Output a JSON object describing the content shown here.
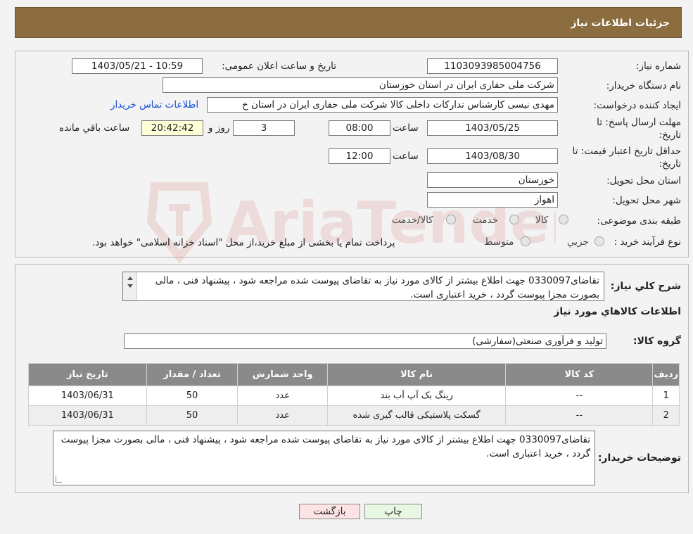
{
  "header": {
    "title": "جزئیات اطلاعات نیاز"
  },
  "form": {
    "need_number_label": "شماره نیاز:",
    "need_number": "1103093985004756",
    "announce_label": "تاریخ و ساعت اعلان عمومی:",
    "announce_value": "1403/05/21 - 10:59",
    "buyer_label": "نام دستگاه خریدار:",
    "buyer_value": "شرکت ملی حفاری ایران در استان خوزستان",
    "creator_label": "ایجاد کننده درخواست:",
    "creator_value": "مهدی نیسی کارشناس تدارکات داخلی کالا شرکت ملی حفاری ایران در استان خ",
    "contact_link": "اطلاعات تماس خریدار",
    "deadline_label_1": "مهلت ارسال پاسخ: تا",
    "deadline_label_2": "تاریخ:",
    "deadline_date": "1403/05/25",
    "time_label": "ساعت",
    "deadline_time": "08:00",
    "days_value": "3",
    "days_label": "روز و",
    "remaining_time": "20:42:42",
    "remaining_label": "ساعت باقي مانده",
    "validity_label_1": "حداقل تاریخ اعتبار قیمت: تا",
    "validity_label_2": "تاریخ:",
    "validity_date": "1403/08/30",
    "validity_time": "12:00",
    "province_label": "استان محل تحویل:",
    "province_value": "خوزستان",
    "city_label": "شهر محل تحویل:",
    "city_value": "اهواز",
    "category_label": "طبقه بندی موضوعی:",
    "category_options": [
      "کالا",
      "خدمت",
      "کالا/خدمت"
    ],
    "process_label": "نوع فرآیند خرید :",
    "process_options": [
      "جزيي",
      "متوسط"
    ],
    "process_note": "پرداخت تمام یا بخشی از مبلغ خرید،از محل \"اسناد خزانه اسلامی\" خواهد بود."
  },
  "description": {
    "label": "شرح کلي نياز:",
    "text": "تقاضای0330097 جهت اطلاع بیشتر از کالای مورد نیاز به تقاضای پیوست شده مراجعه شود ، پیشنهاد فنی ، مالی بصورت مجزا پیوست گردد ، خرید اعتباری است."
  },
  "goods": {
    "section_title": "اطلاعات کالاهاي مورد نياز",
    "group_label": "گروه کالا:",
    "group_value": "تولید و فرآوری صنعتی(سفارشی)",
    "columns": [
      "رديف",
      "کد کالا",
      "نام کالا",
      "واحد شمارش",
      "تعداد / مقدار",
      "تاريخ نياز"
    ],
    "rows": [
      [
        "1",
        "--",
        "رینگ بک آپ آب بند",
        "عدد",
        "50",
        "1403/06/31"
      ],
      [
        "2",
        "--",
        "گسکت پلاستیکی قالب گیری شده",
        "عدد",
        "50",
        "1403/06/31"
      ]
    ]
  },
  "buyer_notes": {
    "label": "توضیحات خریدار:",
    "text": "تقاضای0330097 جهت اطلاع بیشتر از کالای مورد نیاز به تقاضای پیوست شده مراجعه شود ، پیشنهاد فنی ، مالی بصورت مجزا پیوست گردد ، خرید اعتباری است."
  },
  "buttons": {
    "print": "چاپ",
    "back": "بازگشت"
  },
  "watermark": {
    "text": "AriaTender.neT"
  },
  "colors": {
    "header_bg": "#8b6d3f",
    "table_header_bg": "#8a8a8a",
    "back_button_bg": "#fde3e3",
    "print_button_bg": "#e7f7e1",
    "remaining_bg": "#ffffd8",
    "link": "#1a4fd6"
  }
}
